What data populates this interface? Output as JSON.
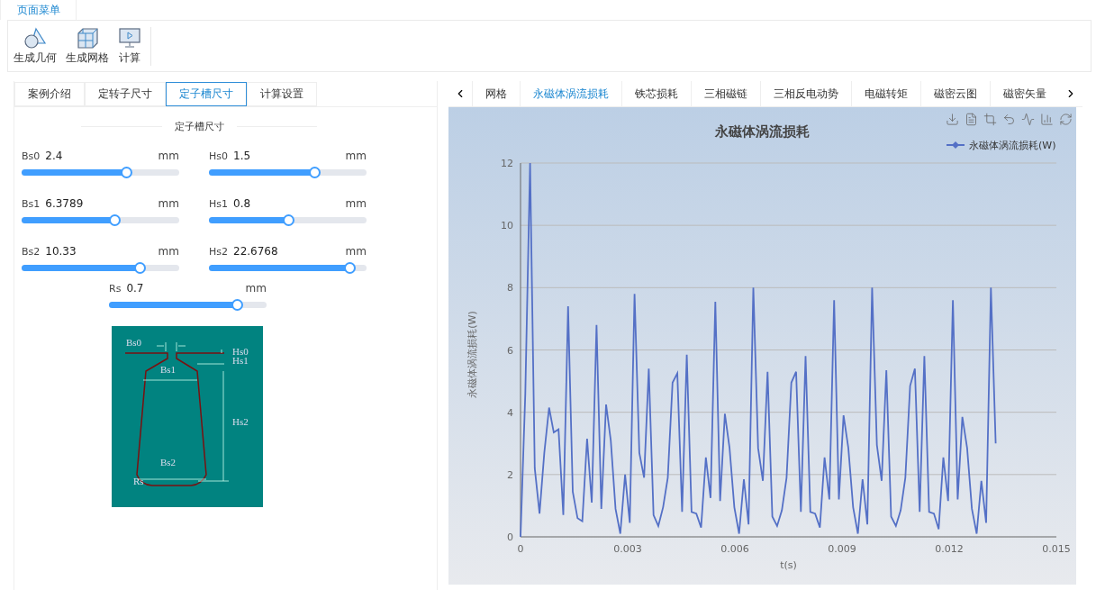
{
  "menu_tab": {
    "label": "页面菜单",
    "selected": true
  },
  "toolbar": [
    {
      "kind": "geometry",
      "label": "生成几何"
    },
    {
      "kind": "mesh",
      "label": "生成网格"
    },
    {
      "kind": "compute",
      "label": "计算"
    }
  ],
  "left_tabs": [
    {
      "label": "案例介绍",
      "selected": false
    },
    {
      "label": "定转子尺寸",
      "selected": false
    },
    {
      "label": "定子槽尺寸",
      "selected": true
    },
    {
      "label": "计算设置",
      "selected": false
    }
  ],
  "section_title": "定子槽尺寸",
  "params": [
    {
      "name": "Bs0",
      "value": "2.4",
      "unit": "mm",
      "level": 0.66
    },
    {
      "name": "Hs0",
      "value": "1.5",
      "unit": "mm",
      "level": 0.67
    },
    {
      "name": "Bs1",
      "value": "6.3789",
      "unit": "mm",
      "level": 0.59
    },
    {
      "name": "Hs1",
      "value": "0.8",
      "unit": "mm",
      "level": 0.5
    },
    {
      "name": "Bs2",
      "value": "10.33",
      "unit": "mm",
      "level": 0.75
    },
    {
      "name": "Hs2",
      "value": "22.6768",
      "unit": "mm",
      "level": 0.89
    },
    {
      "name": "Rs",
      "value": "0.7",
      "unit": "mm",
      "level": 0.81
    }
  ],
  "slot_diagram": {
    "labels": [
      "Bs0",
      "Hs0",
      "Hs1",
      "Bs1",
      "Hs2",
      "Bs2",
      "Rs"
    ]
  },
  "result_tabs": [
    {
      "label": "网格",
      "selected": false
    },
    {
      "label": "永磁体涡流损耗",
      "selected": true
    },
    {
      "label": "铁芯损耗",
      "selected": false
    },
    {
      "label": "三相磁链",
      "selected": false
    },
    {
      "label": "三相反电动势",
      "selected": false
    },
    {
      "label": "电磁转矩",
      "selected": false
    },
    {
      "label": "磁密云图",
      "selected": false
    },
    {
      "label": "磁密矢量",
      "selected": false
    }
  ],
  "chart": {
    "chart_data": {
      "type": "line",
      "grid": true,
      "title": "永磁体涡流损耗",
      "xlabel": "t(s)",
      "ylabel": "永磁体涡流损耗(W)",
      "xlim": [
        0,
        0.015
      ],
      "ylim": [
        0,
        12
      ],
      "xticks": [
        0,
        0.003,
        0.006,
        0.009,
        0.012,
        0.015
      ],
      "yticks": [
        0,
        2,
        4,
        6,
        8,
        10,
        12
      ],
      "x": [
        0,
        0.000133,
        0.000266,
        0.000399,
        0.000532,
        0.000665,
        0.000798,
        0.000931,
        0.001064,
        0.001197,
        0.00133,
        0.001463,
        0.001596,
        0.001729,
        0.001862,
        0.001995,
        0.002128,
        0.002261,
        0.002394,
        0.002527,
        0.00266,
        0.002793,
        0.002926,
        0.003059,
        0.003192,
        0.003325,
        0.003458,
        0.003591,
        0.003724,
        0.003857,
        0.00399,
        0.004123,
        0.004256,
        0.004389,
        0.004522,
        0.004655,
        0.004788,
        0.004921,
        0.005054,
        0.005187,
        0.00532,
        0.005453,
        0.005586,
        0.005719,
        0.005852,
        0.005985,
        0.006118,
        0.006251,
        0.006384,
        0.006517,
        0.00665,
        0.006783,
        0.006916,
        0.007049,
        0.007182,
        0.007315,
        0.007448,
        0.007581,
        0.007714,
        0.007847,
        0.00798,
        0.008113,
        0.008246,
        0.008379,
        0.008512,
        0.008645,
        0.008778,
        0.008911,
        0.009044,
        0.009177,
        0.00931,
        0.009443,
        0.009576,
        0.009709,
        0.009842,
        0.009975,
        0.010108,
        0.010241,
        0.010374,
        0.010507,
        0.01064,
        0.010773,
        0.010906,
        0.011039,
        0.011172,
        0.011305,
        0.011438,
        0.011571,
        0.011704,
        0.011837,
        0.01197,
        0.012103,
        0.012236,
        0.012369,
        0.012502,
        0.012635,
        0.012768,
        0.012901,
        0.013034,
        0.013167,
        0.0133
      ],
      "series": [
        {
          "name": "永磁体涡流损耗(W)",
          "color": "#5470c6",
          "values": [
            0,
            4.6,
            12,
            2.2,
            0.75,
            2.7,
            4.15,
            3.35,
            3.45,
            0.7,
            7.4,
            1.45,
            0.6,
            0.5,
            3.15,
            1.1,
            6.8,
            0.9,
            4.25,
            3.1,
            0.9,
            0.1,
            2.0,
            0.45,
            7.8,
            2.7,
            1.9,
            5.4,
            0.7,
            0.35,
            0.95,
            1.9,
            4.95,
            5.25,
            0.8,
            5.85,
            0.8,
            0.75,
            0.3,
            2.55,
            1.25,
            7.55,
            1.15,
            3.95,
            2.85,
            0.95,
            0.1,
            1.85,
            0.4,
            8.0,
            2.85,
            1.8,
            5.3,
            0.65,
            0.35,
            0.85,
            1.9,
            4.95,
            5.3,
            0.8,
            5.8,
            0.8,
            0.75,
            0.3,
            2.55,
            1.2,
            7.6,
            1.2,
            3.9,
            2.85,
            0.95,
            0.1,
            1.85,
            0.4,
            8.0,
            2.95,
            1.8,
            5.35,
            0.65,
            0.35,
            0.85,
            1.9,
            4.85,
            5.4,
            0.8,
            5.8,
            0.8,
            0.75,
            0.25,
            2.55,
            1.15,
            7.6,
            1.2,
            3.85,
            2.85,
            0.9,
            0.1,
            1.8,
            0.45,
            8.0,
            3.0
          ]
        }
      ]
    }
  }
}
